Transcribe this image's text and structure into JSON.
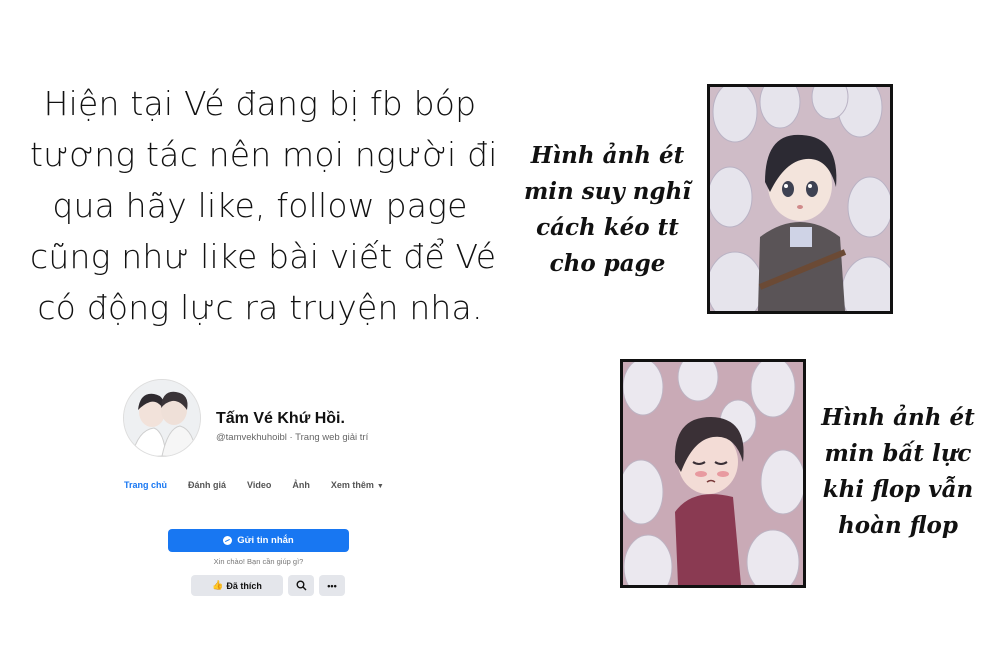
{
  "main_text": {
    "lines": [
      "Hiện tại Vé đang bị fb bóp",
      "tương tác nên mọi người đi",
      "qua hãy like, follow page",
      "cũng như like bài viết để Vé",
      "có động lực ra truyện nha."
    ]
  },
  "captions": {
    "top": [
      "Hình ảnh ét",
      "min suy nghĩ",
      "cách kéo tt",
      "cho page"
    ],
    "bottom": [
      "Hình ảnh ét",
      "min bất lực",
      "khi flop vẫn",
      "hoàn flop"
    ]
  },
  "fb_page": {
    "name": "Tấm Vé Khứ Hồi.",
    "subtitle": "@tamvekhuhoibl · Trang web giải trí",
    "tabs": [
      "Trang chủ",
      "Đánh giá",
      "Video",
      "Ảnh",
      "Xem thêm"
    ],
    "active_tab": "Trang chủ",
    "message_button": "Gửi tin nhắn",
    "message_hint": "Xin chào! Bạn cần giúp gì?",
    "liked_button": "Đã thích",
    "search_icon": "search-icon",
    "more_icon": "more-icon",
    "accent_color": "#1877f2"
  }
}
